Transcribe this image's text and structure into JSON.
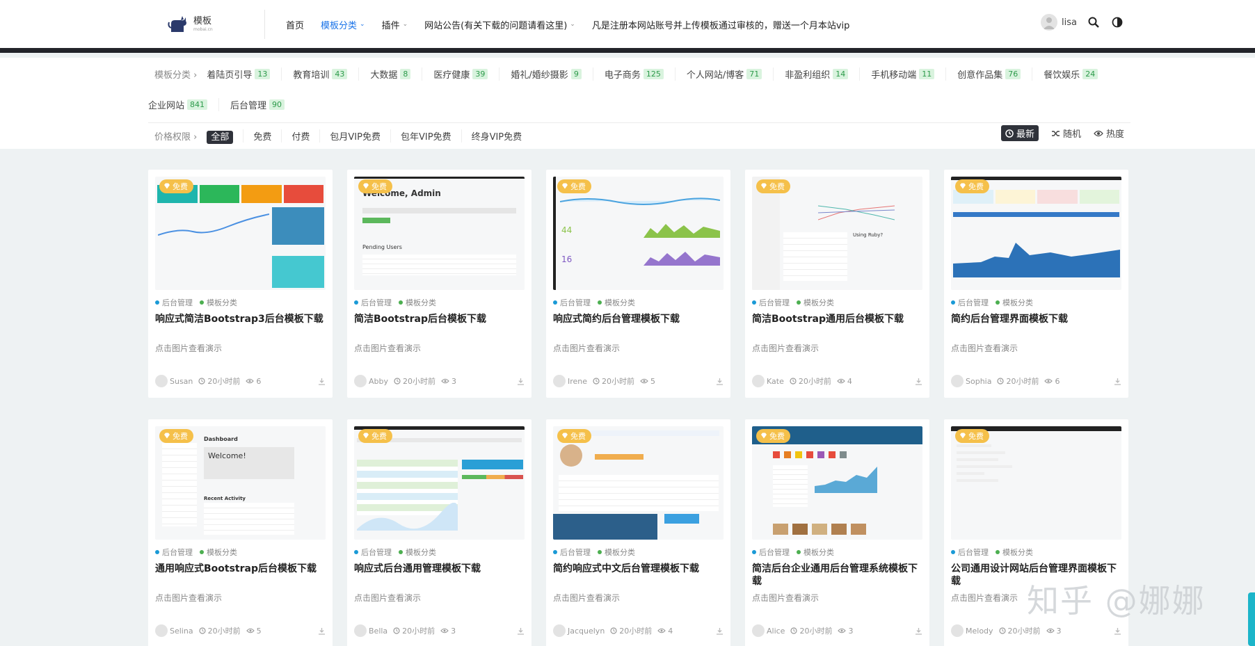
{
  "header": {
    "logo_text": "模板",
    "logo_sub": "mobai.cn",
    "nav": [
      {
        "label": "首页",
        "active": false,
        "dropdown": false
      },
      {
        "label": "模板分类",
        "active": true,
        "dropdown": true
      },
      {
        "label": "插件",
        "active": false,
        "dropdown": true
      },
      {
        "label": "网站公告(有关下载的问题请看这里)",
        "active": false,
        "dropdown": true
      },
      {
        "label": "凡是注册本网站账号并上传模板通过审核的，赠送一个月本站vip",
        "active": false,
        "dropdown": false
      }
    ],
    "username": "lisa"
  },
  "filters": {
    "category_label": "模板分类",
    "categories_row1": [
      {
        "label": "着陆页引导",
        "count": "13"
      },
      {
        "label": "教育培训",
        "count": "43"
      },
      {
        "label": "大数据",
        "count": "8"
      },
      {
        "label": "医疗健康",
        "count": "39"
      },
      {
        "label": "婚礼/婚纱摄影",
        "count": "9"
      },
      {
        "label": "电子商务",
        "count": "125"
      },
      {
        "label": "个人网站/博客",
        "count": "71"
      },
      {
        "label": "非盈利组织",
        "count": "14"
      },
      {
        "label": "手机移动端",
        "count": "11"
      },
      {
        "label": "创意作品集",
        "count": "76"
      },
      {
        "label": "餐饮娱乐",
        "count": "24"
      }
    ],
    "categories_row2": [
      {
        "label": "企业网站",
        "count": "841"
      },
      {
        "label": "后台管理",
        "count": "90"
      }
    ],
    "price_label": "价格权限",
    "price_options": [
      "全部",
      "免费",
      "付费",
      "包月VIP免费",
      "包年VIP免费",
      "终身VIP免费"
    ],
    "sort_options": [
      "最新",
      "随机",
      "热度"
    ]
  },
  "cards": [
    {
      "title": "响应式简洁Bootstrap3后台模板下载",
      "author": "Susan",
      "time": "20小时前",
      "views": "6"
    },
    {
      "title": "简洁Bootstrap后台模板下载",
      "author": "Abby",
      "time": "20小时前",
      "views": "3"
    },
    {
      "title": "响应式简约后台管理模板下载",
      "author": "Irene",
      "time": "20小时前",
      "views": "5"
    },
    {
      "title": "简洁Bootstrap通用后台模板下载",
      "author": "Kate",
      "time": "20小时前",
      "views": "4"
    },
    {
      "title": "简约后台管理界面模板下载",
      "author": "Sophia",
      "time": "20小时前",
      "views": "6"
    },
    {
      "title": "通用响应式Bootstrap后台模板下载",
      "author": "Selina",
      "time": "20小时前",
      "views": "5"
    },
    {
      "title": "响应式后台通用管理模板下载",
      "author": "Bella",
      "time": "20小时前",
      "views": "3"
    },
    {
      "title": "简约响应式中文后台管理模板下载",
      "author": "Jacquelyn",
      "time": "20小时前",
      "views": "4"
    },
    {
      "title": "简洁后台企业通用后台管理系统模板下载",
      "author": "Alice",
      "time": "20小时前",
      "views": "3"
    },
    {
      "title": "公司通用设计网站后台管理界面模板下载",
      "author": "Melody",
      "time": "20小时前",
      "views": "3"
    }
  ],
  "card_common": {
    "free_tag": "免费",
    "cat1": "后台管理",
    "cat2": "模板分类",
    "desc": "点击图片查看演示"
  },
  "watermark": "知乎 @娜娜",
  "colors": {
    "accent": "#1a73e8",
    "badge_bg": "#d9f3de",
    "badge_text": "#2c9a4a",
    "free_tag": "#f5c04a",
    "dark": "#2f323a"
  }
}
